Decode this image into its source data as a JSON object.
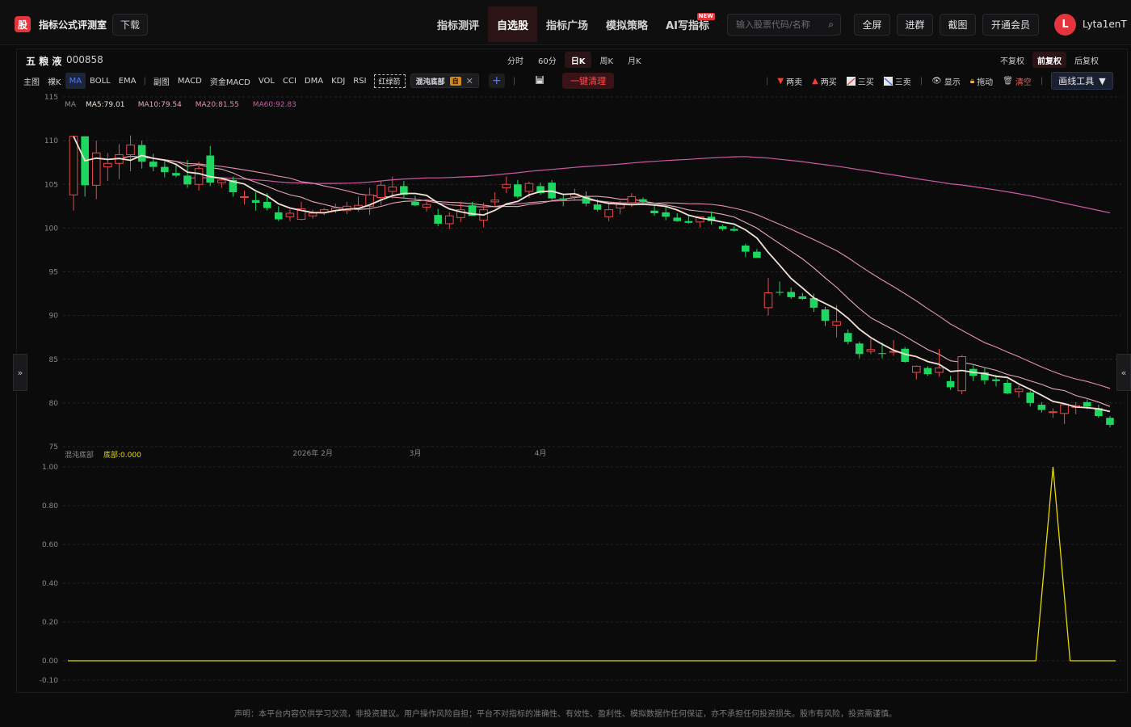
{
  "app": {
    "logo_char": "股",
    "name": "指标公式评测室",
    "download_label": "下载"
  },
  "nav": {
    "tabs": [
      {
        "label": "指标测评",
        "active": false
      },
      {
        "label": "自选股",
        "active": true
      },
      {
        "label": "指标广场",
        "active": false
      },
      {
        "label": "模拟策略",
        "active": false
      },
      {
        "label": "AI写指标",
        "active": false,
        "badge": "NEW"
      }
    ],
    "search_placeholder": "输入股票代码/名称",
    "buttons": [
      "全屏",
      "进群",
      "截图",
      "开通会员"
    ],
    "avatar_letter": "L",
    "username": "Lyta1enT"
  },
  "stock": {
    "name": "五 粮 液",
    "code": "000858"
  },
  "periods": [
    {
      "label": "分时",
      "active": false
    },
    {
      "label": "60分",
      "active": false
    },
    {
      "label": "日K",
      "active": true
    },
    {
      "label": "周K",
      "active": false
    },
    {
      "label": "月K",
      "active": false
    }
  ],
  "adjust": [
    {
      "label": "不复权",
      "active": false
    },
    {
      "label": "前复权",
      "active": true
    },
    {
      "label": "后复权",
      "active": false
    }
  ],
  "toolbar": {
    "main_label": "主图",
    "main_items": [
      {
        "label": "裸K",
        "active": false
      },
      {
        "label": "MA",
        "active": true
      },
      {
        "label": "BOLL",
        "active": false
      },
      {
        "label": "EMA",
        "active": false
      }
    ],
    "sub_label": "副图",
    "sub_items": [
      "MACD",
      "资金MACD",
      "VOL",
      "CCI",
      "DMA",
      "KDJ",
      "RSI"
    ],
    "redgreen_label": "红绿箭",
    "indicator_chip": {
      "label": "混沌底部",
      "tag": "自"
    },
    "clear_label": "一键清理"
  },
  "drawtools": {
    "items": [
      {
        "label": "两卖",
        "icon": "triangle-down-icon"
      },
      {
        "label": "两买",
        "icon": "triangle-up-icon"
      },
      {
        "label": "三买",
        "icon": "line-up-icon"
      },
      {
        "label": "三卖",
        "icon": "line-down-icon"
      },
      {
        "label": "显示",
        "icon": "eye-icon"
      },
      {
        "label": "拖动",
        "icon": "lock-icon"
      },
      {
        "label": "清空",
        "icon": "trash-icon"
      }
    ],
    "draw_button": "画线工具"
  },
  "ma_legend": {
    "label": "MA",
    "items": [
      {
        "text": "MA5:79.01",
        "color": "#f1e2d3"
      },
      {
        "text": "MA10:79.54",
        "color": "#e8a9b8"
      },
      {
        "text": "MA20:81.55",
        "color": "#e58fb0"
      },
      {
        "text": "MA60:92.83",
        "color": "#cf5aa3"
      }
    ]
  },
  "sub_legend": {
    "label": "混沌底部",
    "item": "底部:0.000",
    "color": "#e6d800"
  },
  "colors": {
    "up": "#e84a4a",
    "down": "#1ed760",
    "accent": "#e5343c"
  },
  "chart_data": [
    {
      "type": "candlestick",
      "title": "",
      "ylim": [
        75,
        115
      ],
      "y_ticks": [
        115,
        110,
        105,
        100,
        95,
        90,
        85,
        80,
        75
      ],
      "x_labels": [
        {
          "label": "2026年 2月",
          "index": 21
        },
        {
          "label": "3月",
          "index": 30
        },
        {
          "label": "4月",
          "index": 41
        }
      ],
      "ohlc": [
        [
          103.8,
          110.5,
          102.0,
          110.5
        ],
        [
          110.5,
          110.5,
          103.6,
          104.9
        ],
        [
          104.9,
          110.0,
          103.3,
          108.6
        ],
        [
          107.0,
          108.6,
          105.4,
          107.4
        ],
        [
          107.4,
          109.6,
          105.6,
          108.4
        ],
        [
          108.4,
          110.6,
          106.5,
          109.5
        ],
        [
          109.5,
          110.0,
          106.8,
          107.6
        ],
        [
          107.6,
          108.5,
          106.5,
          107.0
        ],
        [
          107.0,
          107.8,
          105.8,
          106.4
        ],
        [
          106.3,
          107.4,
          105.8,
          106.0
        ],
        [
          106.0,
          107.8,
          104.6,
          105.0
        ],
        [
          105.0,
          107.6,
          104.3,
          106.8
        ],
        [
          108.3,
          109.4,
          104.8,
          105.2
        ],
        [
          105.2,
          105.8,
          104.6,
          105.5
        ],
        [
          105.5,
          105.9,
          103.6,
          104.1
        ],
        [
          103.5,
          104.3,
          102.7,
          103.6
        ],
        [
          103.2,
          104.1,
          102.0,
          102.9
        ],
        [
          103.0,
          104.0,
          102.0,
          102.3
        ],
        [
          101.8,
          102.5,
          100.8,
          101.0
        ],
        [
          101.3,
          102.1,
          100.8,
          101.7
        ],
        [
          101.0,
          103.0,
          100.9,
          102.2
        ],
        [
          101.4,
          102.1,
          101.1,
          101.7
        ],
        [
          101.8,
          102.3,
          101.5,
          102.1
        ],
        [
          102.0,
          102.8,
          101.7,
          102.3
        ],
        [
          102.0,
          103.0,
          101.6,
          102.5
        ],
        [
          102.3,
          103.6,
          101.9,
          102.6
        ],
        [
          102.5,
          104.6,
          101.5,
          103.8
        ],
        [
          103.5,
          105.4,
          102.6,
          104.9
        ],
        [
          104.2,
          105.9,
          103.4,
          104.7
        ],
        [
          104.8,
          105.4,
          103.4,
          103.8
        ],
        [
          103.0,
          103.7,
          102.5,
          102.6
        ],
        [
          102.4,
          103.3,
          101.9,
          102.7
        ],
        [
          101.5,
          102.2,
          100.2,
          100.5
        ],
        [
          100.5,
          101.8,
          99.9,
          101.4
        ],
        [
          101.2,
          102.9,
          100.7,
          102.1
        ],
        [
          102.6,
          103.0,
          101.6,
          101.4
        ],
        [
          100.9,
          102.9,
          100.1,
          102.1
        ],
        [
          103.0,
          104.1,
          102.5,
          103.2
        ],
        [
          104.6,
          105.9,
          104.0,
          105.0
        ],
        [
          105.0,
          105.5,
          103.4,
          103.6
        ],
        [
          104.2,
          105.3,
          103.5,
          105.1
        ],
        [
          104.8,
          105.2,
          103.8,
          104.0
        ],
        [
          105.2,
          105.5,
          103.2,
          103.4
        ],
        [
          103.4,
          103.9,
          102.5,
          103.2
        ],
        [
          103.6,
          104.5,
          103.1,
          103.9
        ],
        [
          103.6,
          104.2,
          102.5,
          102.8
        ],
        [
          102.7,
          103.3,
          101.9,
          102.1
        ],
        [
          101.3,
          102.9,
          100.8,
          102.1
        ],
        [
          102.3,
          103.1,
          101.6,
          102.8
        ],
        [
          102.9,
          104.0,
          102.4,
          103.6
        ],
        [
          103.3,
          103.5,
          102.9,
          103.0
        ],
        [
          102.0,
          102.7,
          101.4,
          101.7
        ],
        [
          101.8,
          102.4,
          100.9,
          101.3
        ],
        [
          101.2,
          101.7,
          100.7,
          100.8
        ],
        [
          100.8,
          101.4,
          100.5,
          100.6
        ],
        [
          100.7,
          101.3,
          100.1,
          101.3
        ],
        [
          101.3,
          101.9,
          100.4,
          100.8
        ],
        [
          100.2,
          100.4,
          99.7,
          99.9
        ],
        [
          99.9,
          100.2,
          99.6,
          99.7
        ],
        [
          98.0,
          98.2,
          96.7,
          97.3
        ],
        [
          97.3,
          97.6,
          96.6,
          96.6
        ],
        [
          90.9,
          94.3,
          90.0,
          92.6
        ],
        [
          92.7,
          93.9,
          92.3,
          92.6
        ],
        [
          92.7,
          93.2,
          91.9,
          92.1
        ],
        [
          92.2,
          92.6,
          91.8,
          91.9
        ],
        [
          92.0,
          92.5,
          90.4,
          90.9
        ],
        [
          90.7,
          91.0,
          88.8,
          89.4
        ],
        [
          88.9,
          91.2,
          87.5,
          89.3
        ],
        [
          88.0,
          88.4,
          86.7,
          87.0
        ],
        [
          86.8,
          87.0,
          85.1,
          85.6
        ],
        [
          85.9,
          87.3,
          85.6,
          86.1
        ],
        [
          85.7,
          86.9,
          85.1,
          85.6
        ],
        [
          85.8,
          87.2,
          85.4,
          85.9
        ],
        [
          86.2,
          86.4,
          84.6,
          84.7
        ],
        [
          83.5,
          84.3,
          82.7,
          84.2
        ],
        [
          84.0,
          84.2,
          83.1,
          83.3
        ],
        [
          83.5,
          86.2,
          83.0,
          84.0
        ],
        [
          82.5,
          83.1,
          81.5,
          81.8
        ],
        [
          81.4,
          85.5,
          81.0,
          85.3
        ],
        [
          83.9,
          84.3,
          82.5,
          83.1
        ],
        [
          83.5,
          84.1,
          82.1,
          82.6
        ],
        [
          82.7,
          83.2,
          81.9,
          82.5
        ],
        [
          82.3,
          82.7,
          81.0,
          81.1
        ],
        [
          81.3,
          82.0,
          80.6,
          81.6
        ],
        [
          81.2,
          81.4,
          79.6,
          80.0
        ],
        [
          79.8,
          80.1,
          78.9,
          79.2
        ],
        [
          78.9,
          79.4,
          78.3,
          79.0
        ],
        [
          78.8,
          79.9,
          77.6,
          79.8
        ],
        [
          79.5,
          80.1,
          78.7,
          79.7
        ],
        [
          80.1,
          80.4,
          79.3,
          79.6
        ],
        [
          79.4,
          79.8,
          78.3,
          78.5
        ],
        [
          78.3,
          78.5,
          77.2,
          77.5
        ]
      ]
    },
    {
      "type": "line",
      "title": "",
      "ylim": [
        -0.1,
        1.0
      ],
      "y_ticks": [
        1.0,
        0.8,
        0.6,
        0.4,
        0.2,
        0.0,
        -0.1
      ],
      "series": [
        {
          "name": "底部",
          "spike_index": 86,
          "spike_value": 1.0,
          "base_value": 0.0
        }
      ]
    }
  ],
  "disclaimer": "声明：本平台内容仅供学习交流，非投资建议。用户操作风险自担；平台不对指标的准确性、有效性、盈利性、模拟数据作任何保证，亦不承担任何投资损失。股市有风险，投资需谨慎。"
}
